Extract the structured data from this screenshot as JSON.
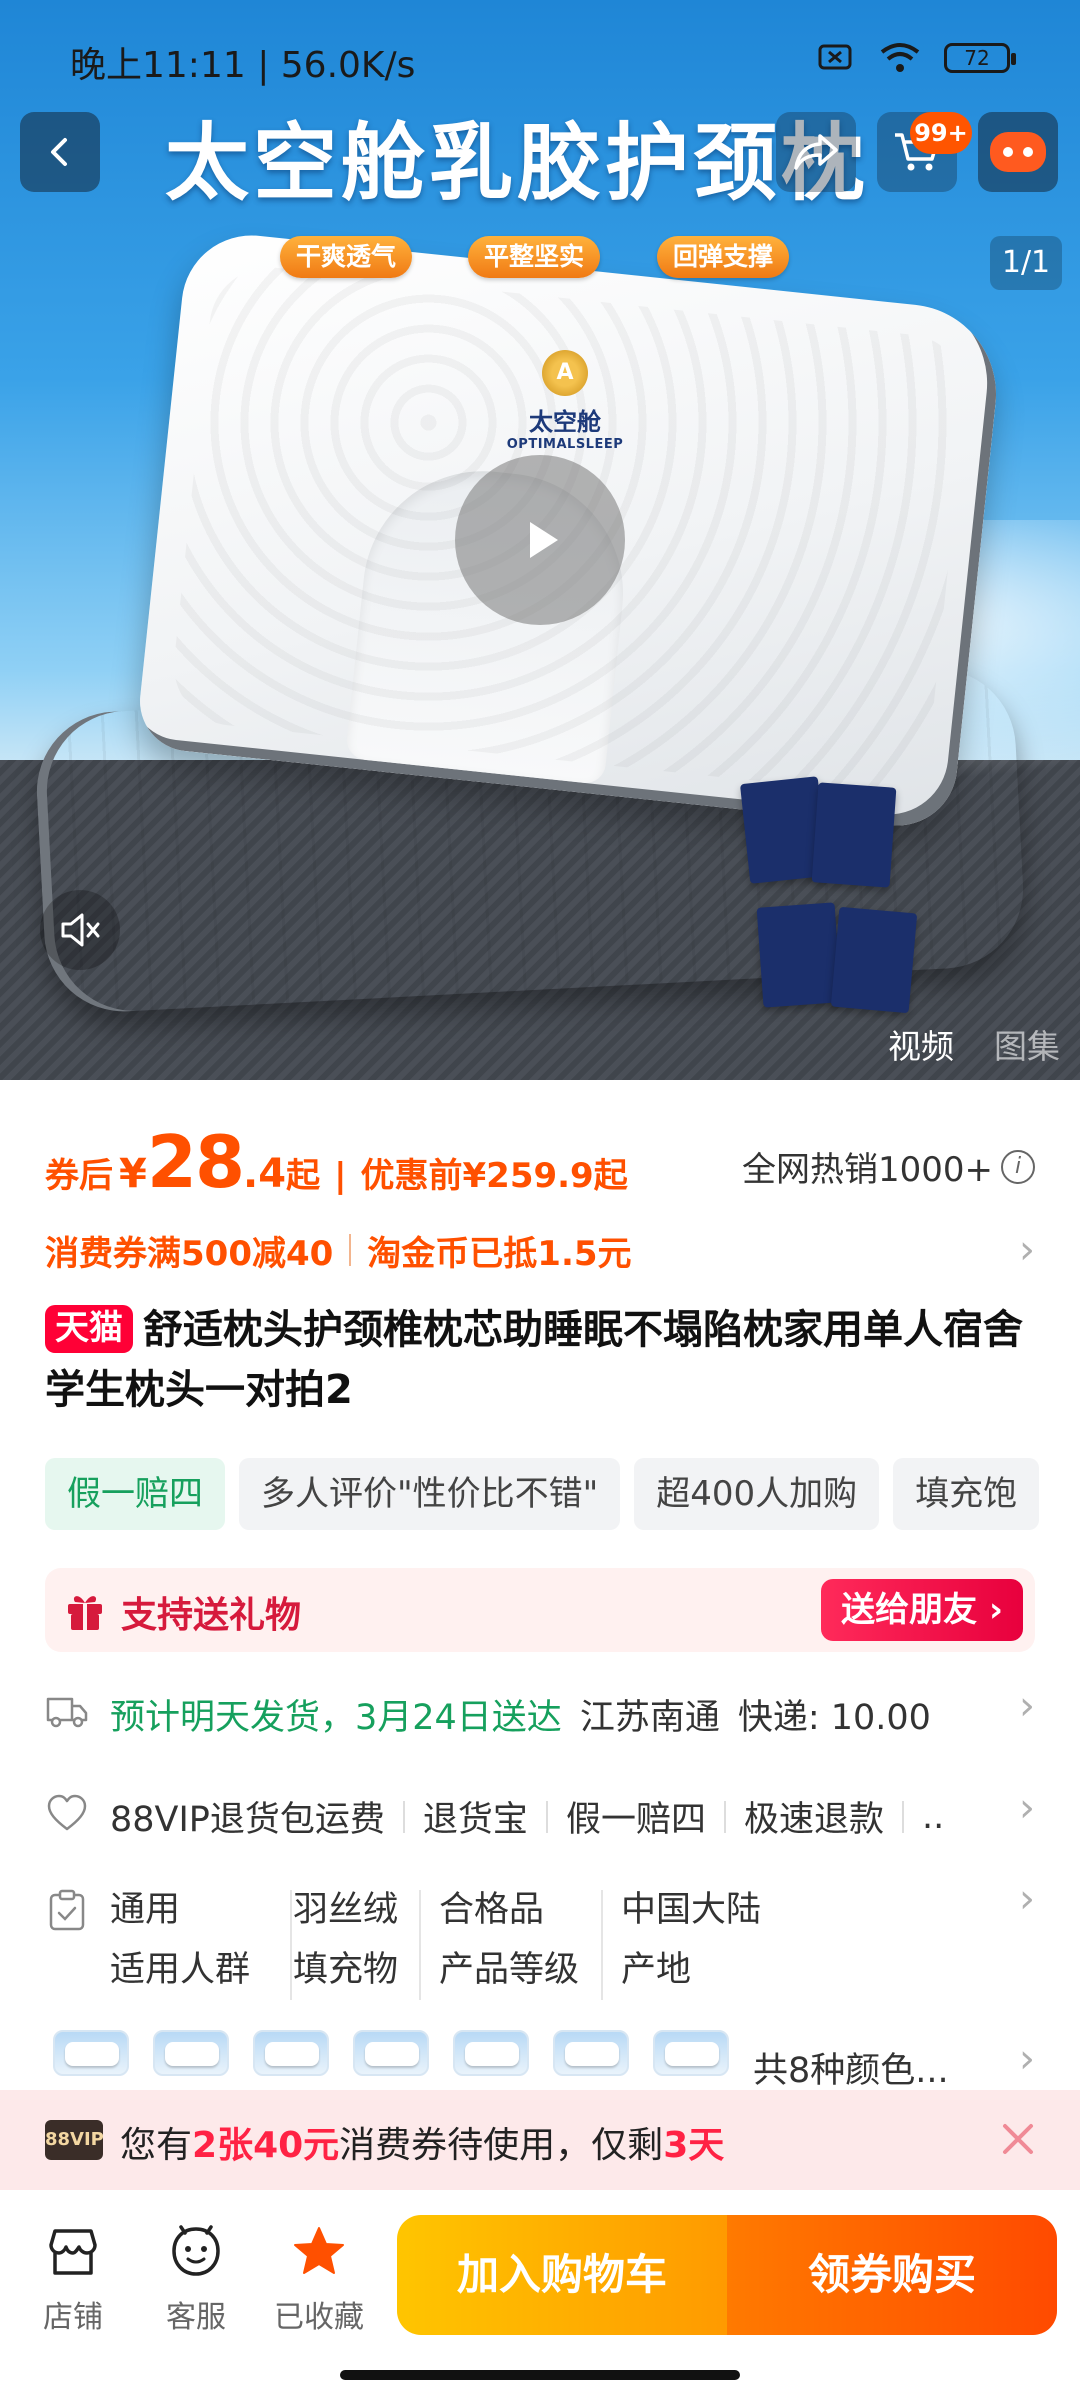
{
  "status_bar": {
    "time_speed": "晚上11:11 | 56.0K/s",
    "battery": "72"
  },
  "hero": {
    "banner_title": "太空舱乳胶护颈枕",
    "features": [
      "干爽透气",
      "平整坚实",
      "回弹支撑"
    ],
    "brand_cn": "太空舱",
    "brand_en": "OPTIMALSLEEP",
    "cart_badge": "99+",
    "page_indicator": "1/1",
    "media_tabs": [
      "视频",
      "图集"
    ]
  },
  "price": {
    "after_coupon_label": "券后",
    "currency": "¥",
    "price_int": "28",
    "price_dec": ".4",
    "from": "起",
    "separator": "|",
    "before_label": "优惠前",
    "before_price": "¥259.9",
    "sales_text": "全网热销1000+"
  },
  "promo": {
    "coupon_text": "消费券满500减40",
    "coin_text": "淘金币已抵1.5元"
  },
  "product": {
    "platform_badge": "天猫",
    "title": "舒适枕头护颈椎枕芯助睡眠不塌陷枕家用单人宿舍学生枕头一对拍2"
  },
  "chips": [
    "假一赔四",
    "多人评价\"性价比不错\"",
    "超400人加购",
    "填充饱"
  ],
  "gift": {
    "label": "支持送礼物",
    "button": "送给朋友 ›"
  },
  "shipping": {
    "eta": "预计明天发货，3月24日送达",
    "origin": "江苏南通",
    "fee": "快递: 10.00"
  },
  "services": [
    "88VIP退货包运费",
    "退货宝",
    "假一赔四",
    "极速退款",
    ".."
  ],
  "specs": [
    {
      "value": "通用",
      "key": "适用人群"
    },
    {
      "value": "羽丝绒",
      "key": "填充物"
    },
    {
      "value": "合格品",
      "key": "产品等级"
    },
    {
      "value": "中国大陆",
      "key": "产地"
    }
  ],
  "variants_count": "共8种颜色...",
  "coupon_strip": {
    "vip_badge": "88VIP",
    "prefix": "您有",
    "highlight_count": "2张40元",
    "middle": "消费券待使用，仅剩",
    "highlight_days": "3天"
  },
  "bottom": {
    "shop": "店铺",
    "service": "客服",
    "favorited": "已收藏",
    "add_to_cart": "加入购物车",
    "buy_with_coupon": "领券购买"
  },
  "colors": {
    "price_orange": "#ff5000",
    "tmall_red": "#ff0036",
    "green": "#16a05d",
    "gift_red": "#e8003d",
    "star": "#ff5000"
  }
}
